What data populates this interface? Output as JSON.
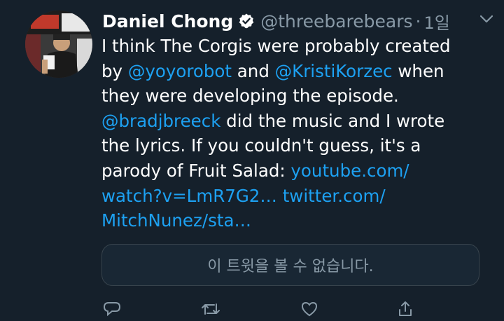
{
  "tweet": {
    "author_name": "Daniel Chong",
    "handle": "@threebarebears",
    "separator": "·",
    "time": "1일",
    "body": {
      "line1": "I think The Corgis were probably created",
      "line2_pre": "by ",
      "mention1": "@yoyorobot",
      "line2_mid": " and ",
      "mention2": "@KristiKorzec",
      "line2_post": " when",
      "line3": "they were developing the episode.",
      "mention3": "@bradjbreeck",
      "line4_post": " did the music and I wrote",
      "line5": "the lyrics. If you couldn't guess, it's a",
      "line6_pre": "parody of Fruit Salad: ",
      "link1_part1": "youtube.com/",
      "link1_part2": "watch?v=LmR7G2…",
      "link_sep": " ",
      "link2_part1": "twitter.com/",
      "link2_part2": "MitchNunez/sta…"
    },
    "unavailable_text": "이 트윗을 볼 수 없습니다."
  },
  "colors": {
    "background": "#15202b",
    "link": "#1da1f2",
    "muted": "#8899a6",
    "verified": "#1da1f2"
  },
  "icons": {
    "verified": "verified-badge-icon",
    "chevron": "chevron-down-icon",
    "reply": "reply-icon",
    "retweet": "retweet-icon",
    "like": "heart-icon",
    "share": "share-icon"
  }
}
